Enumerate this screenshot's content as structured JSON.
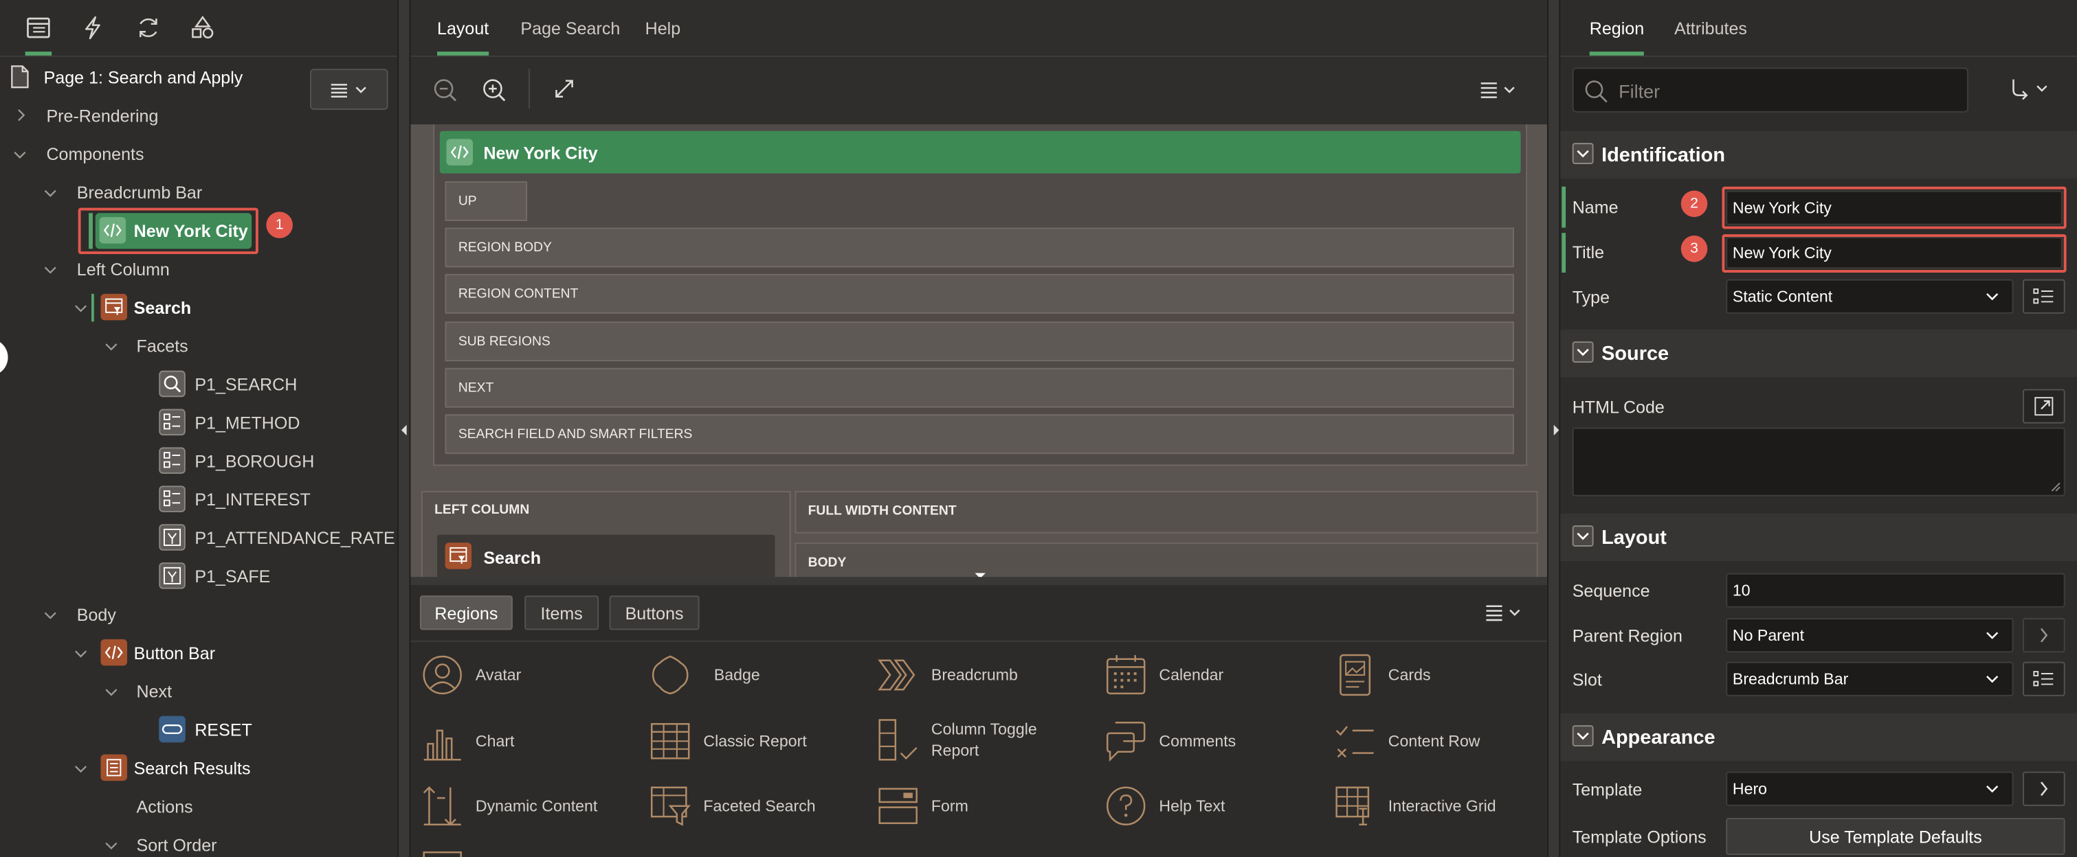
{
  "left": {
    "page_title": "Page 1: Search and Apply",
    "tree": {
      "pre_rendering": "Pre-Rendering",
      "components": "Components",
      "breadcrumb_bar": "Breadcrumb Bar",
      "new_york_city": "New York City",
      "left_column": "Left Column",
      "search": "Search",
      "facets": "Facets",
      "p1_search": "P1_SEARCH",
      "p1_method": "P1_METHOD",
      "p1_borough": "P1_BOROUGH",
      "p1_interest": "P1_INTEREST",
      "p1_attendance_rate": "P1_ATTENDANCE_RATE",
      "p1_safe": "P1_SAFE",
      "body": "Body",
      "button_bar": "Button Bar",
      "next": "Next",
      "reset": "RESET",
      "search_results": "Search Results",
      "actions": "Actions",
      "sort_order": "Sort Order"
    },
    "badge_1": "1"
  },
  "center": {
    "tabs": [
      "Layout",
      "Page Search",
      "Help"
    ],
    "canvas": {
      "hero_title": "New York City",
      "rows": [
        "UP",
        "REGION BODY",
        "REGION CONTENT",
        "SUB REGIONS",
        "NEXT",
        "SEARCH FIELD AND SMART FILTERS"
      ],
      "left_column": "LEFT COLUMN",
      "full_width": "FULL WIDTH CONTENT",
      "search": "Search",
      "body": "BODY"
    },
    "gallery_tabs": [
      "Regions",
      "Items",
      "Buttons"
    ],
    "gallery": [
      "Avatar",
      "Badge",
      "Breadcrumb",
      "Calendar",
      "Cards",
      "Chart",
      "Classic Report",
      "Column Toggle Report",
      "Comments",
      "Content Row",
      "Dynamic Content",
      "Faceted Search",
      "Form",
      "Help Text",
      "Interactive Grid"
    ]
  },
  "right": {
    "tabs": [
      "Region",
      "Attributes"
    ],
    "filter_placeholder": "Filter",
    "identification": {
      "title": "Identification",
      "name_label": "Name",
      "name_value": "New York City",
      "title_label": "Title",
      "title_value": "New York City",
      "type_label": "Type",
      "type_value": "Static Content",
      "badge_2": "2",
      "badge_3": "3"
    },
    "source": {
      "title": "Source",
      "html_label": "HTML Code"
    },
    "layout": {
      "title": "Layout",
      "sequence_label": "Sequence",
      "sequence_value": "10",
      "parent_label": "Parent Region",
      "parent_value": "No Parent",
      "slot_label": "Slot",
      "slot_value": "Breadcrumb Bar"
    },
    "appearance": {
      "title": "Appearance",
      "template_label": "Template",
      "template_value": "Hero",
      "options_label": "Template Options",
      "options_button": "Use Template Defaults"
    }
  }
}
